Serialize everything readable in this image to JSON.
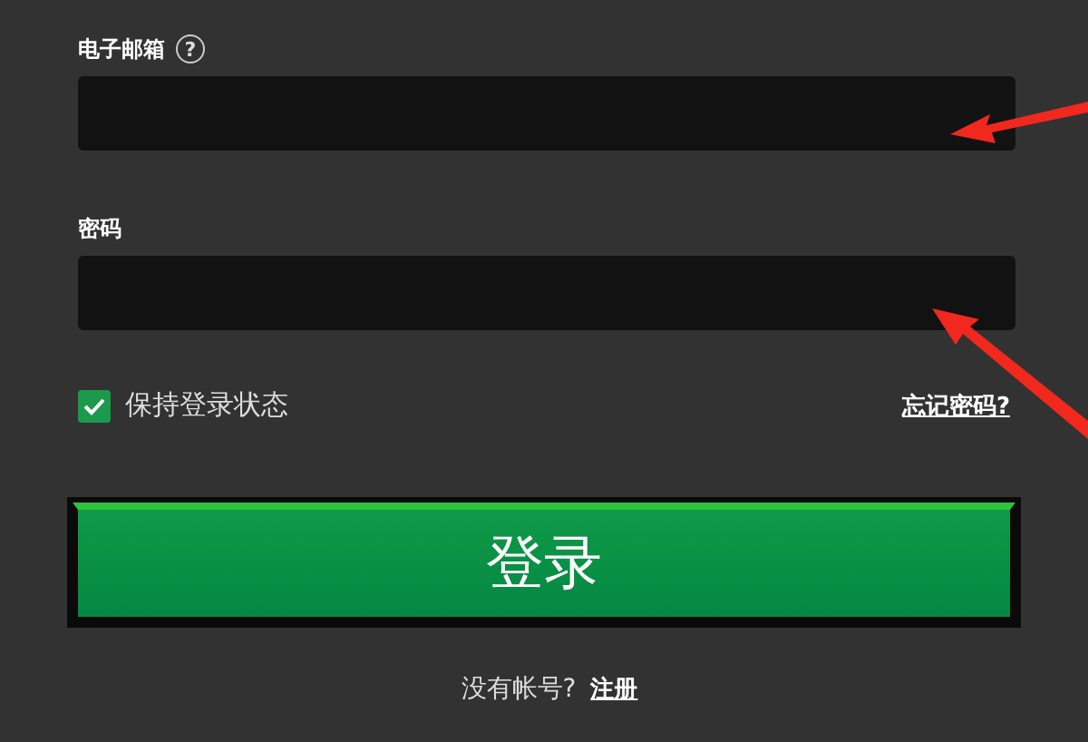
{
  "email": {
    "label": "电子邮箱",
    "help": "?"
  },
  "password": {
    "label": "密码"
  },
  "remember": {
    "label": "保持登录状态",
    "checked": true
  },
  "forgot_link": "忘记密码?",
  "login_button": "登录",
  "signup": {
    "prompt": "没有帐号?",
    "link": "注册"
  }
}
